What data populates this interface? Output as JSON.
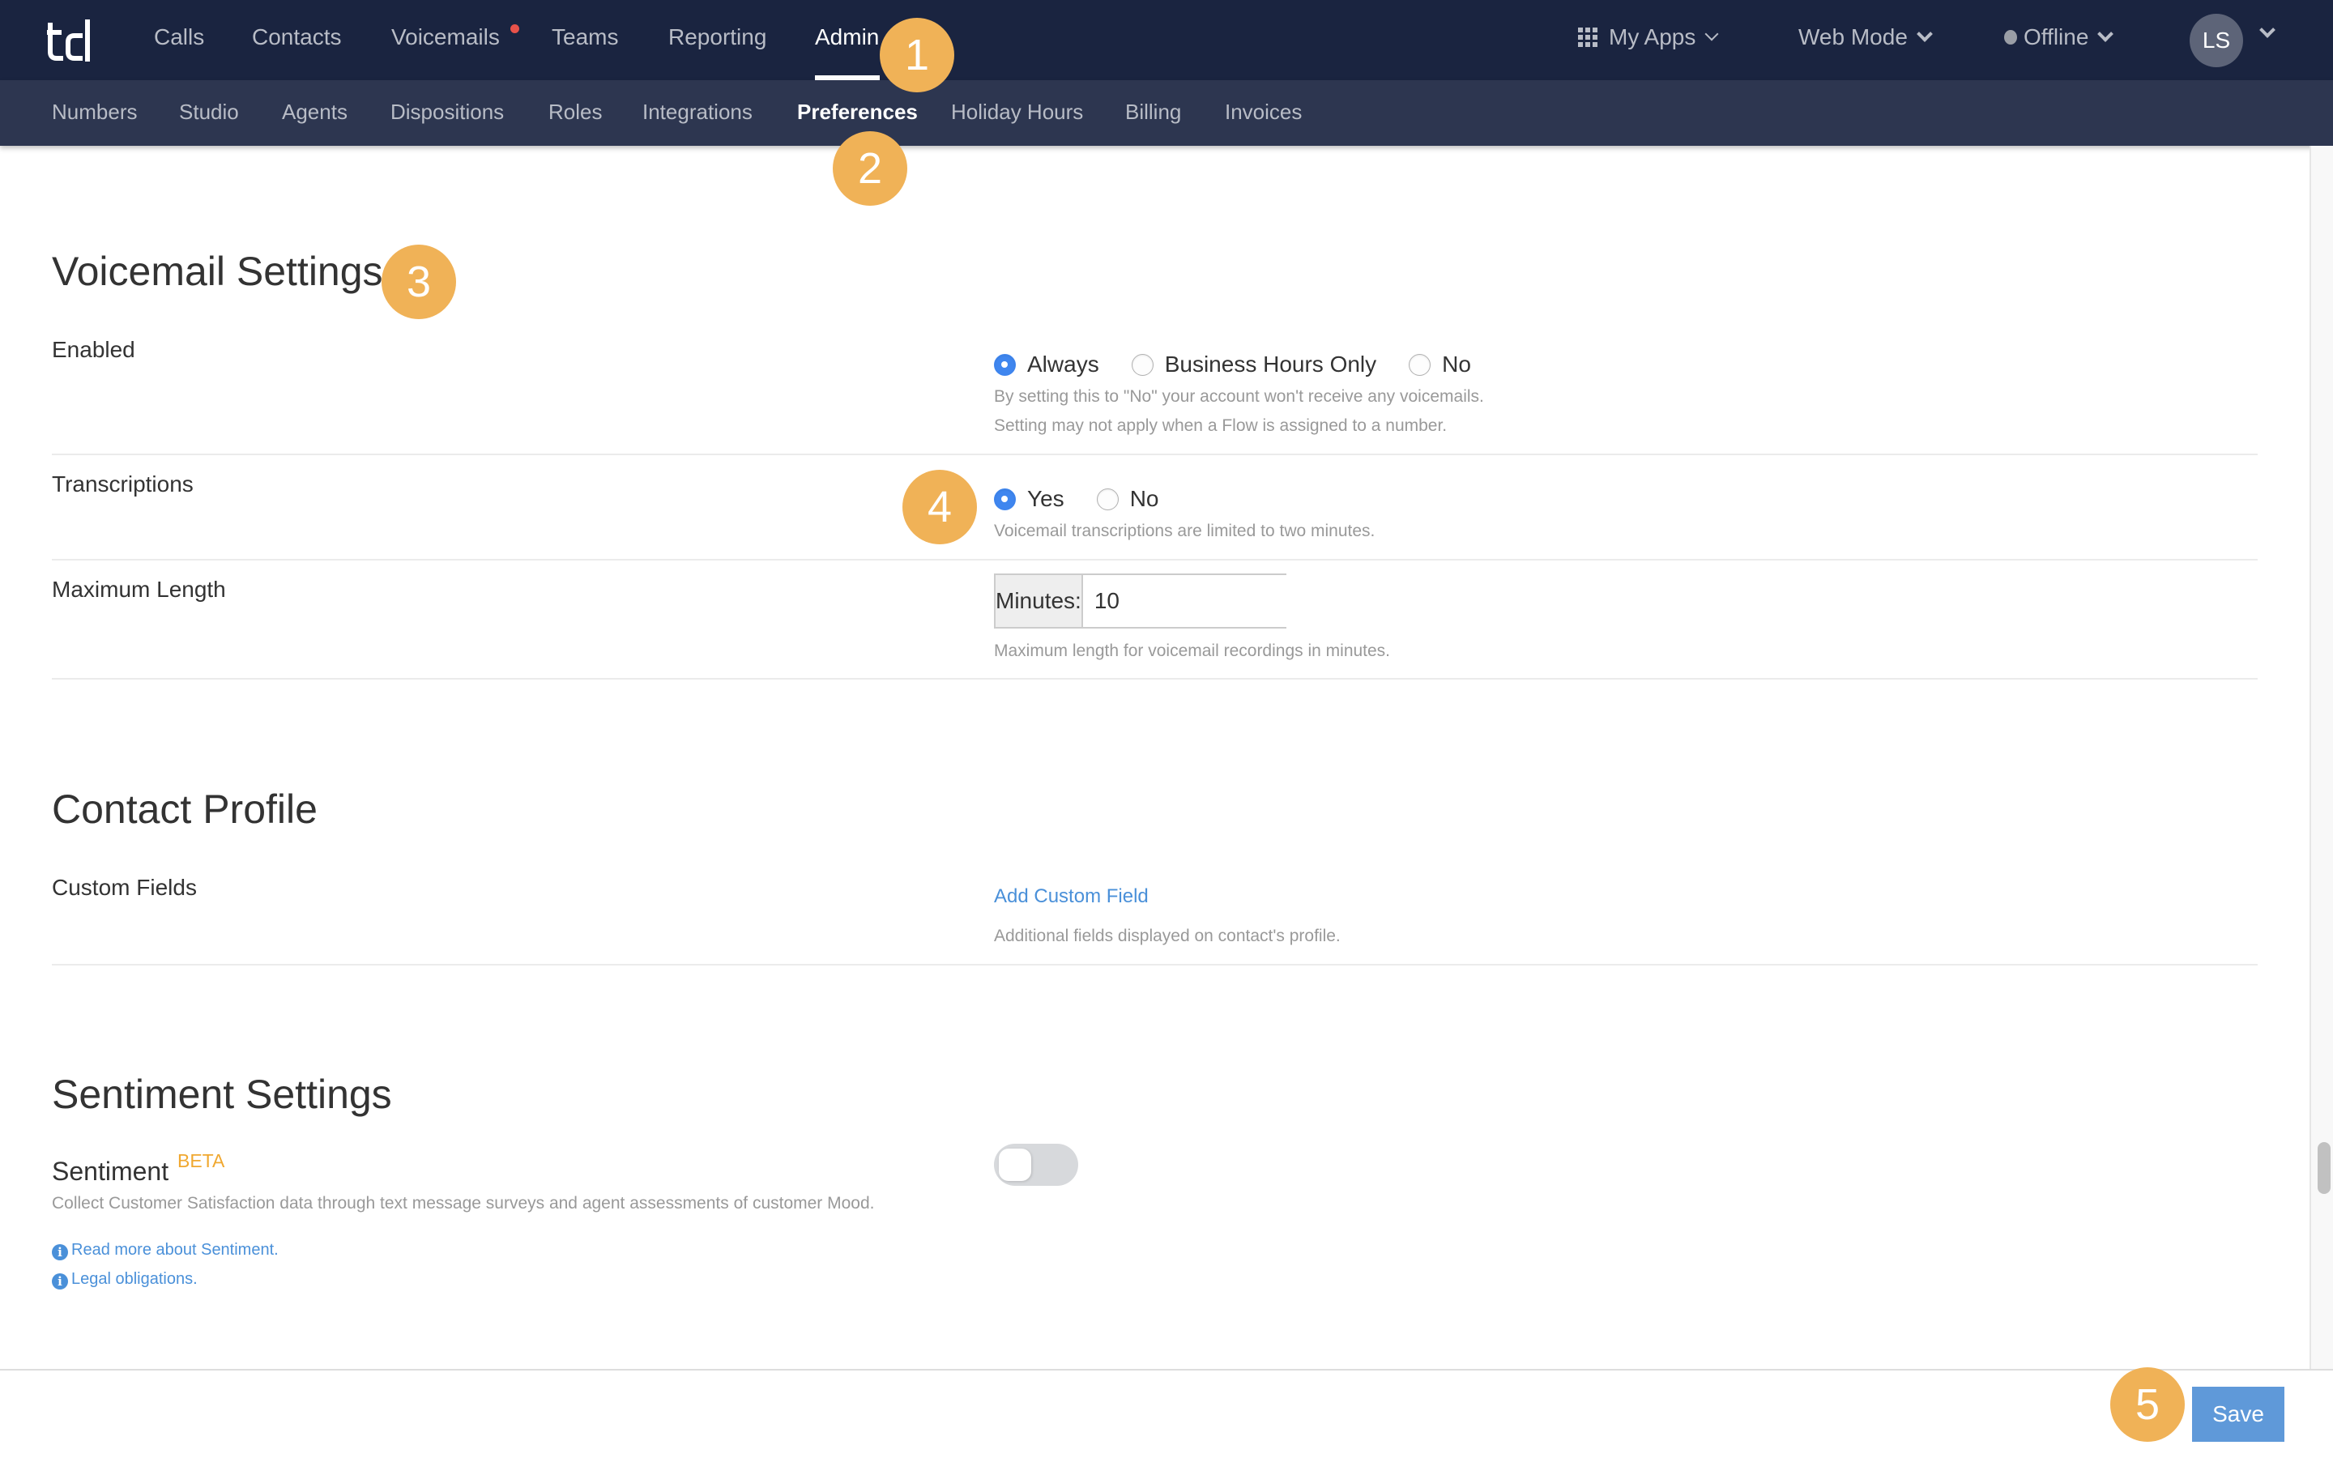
{
  "topnav": {
    "logo": "td",
    "items": [
      {
        "label": "Calls",
        "active": false
      },
      {
        "label": "Contacts",
        "active": false
      },
      {
        "label": "Voicemails",
        "active": false,
        "notification": true
      },
      {
        "label": "Teams",
        "active": false
      },
      {
        "label": "Reporting",
        "active": false
      },
      {
        "label": "Admin",
        "active": true
      }
    ],
    "my_apps": "My Apps",
    "web_mode": "Web Mode",
    "status": "Offline",
    "avatar_initials": "LS"
  },
  "subnav": {
    "items": [
      {
        "label": "Numbers"
      },
      {
        "label": "Studio"
      },
      {
        "label": "Agents"
      },
      {
        "label": "Dispositions"
      },
      {
        "label": "Roles"
      },
      {
        "label": "Integrations"
      },
      {
        "label": "Preferences",
        "active": true
      },
      {
        "label": "Holiday Hours"
      },
      {
        "label": "Billing"
      },
      {
        "label": "Invoices"
      }
    ]
  },
  "annotations": [
    "1",
    "2",
    "3",
    "4",
    "5"
  ],
  "voicemail": {
    "title": "Voicemail Settings",
    "enabled": {
      "label": "Enabled",
      "options": [
        "Always",
        "Business Hours Only",
        "No"
      ],
      "selected": "Always",
      "help1": "By setting this to \"No\" your account won't receive any voicemails.",
      "help2": "Setting may not apply when a Flow is assigned to a number."
    },
    "transcriptions": {
      "label": "Transcriptions",
      "options": [
        "Yes",
        "No"
      ],
      "selected": "Yes",
      "help": "Voicemail transcriptions are limited to two minutes."
    },
    "max_length": {
      "label": "Maximum Length",
      "addon": "Minutes:",
      "value": "10",
      "help": "Maximum length for voicemail recordings in minutes."
    }
  },
  "contact_profile": {
    "title": "Contact Profile",
    "custom_fields": {
      "label": "Custom Fields",
      "link": "Add Custom Field",
      "help": "Additional fields displayed on contact's profile."
    }
  },
  "sentiment": {
    "title": "Sentiment Settings",
    "label": "Sentiment",
    "badge": "BETA",
    "description": "Collect Customer Satisfaction data through text message surveys and agent assessments of customer Mood.",
    "link_read_more": "Read more about Sentiment.",
    "link_legal": "Legal obligations.",
    "enabled": false
  },
  "footer": {
    "save_label": "Save"
  },
  "colors": {
    "nav_bg": "#1a2440",
    "subnav_bg": "#2d3650",
    "accent_blue": "#3f86ef",
    "annotation_orange": "#f0b257",
    "link_blue": "#4a90d9",
    "save_blue": "#5f99d9"
  }
}
